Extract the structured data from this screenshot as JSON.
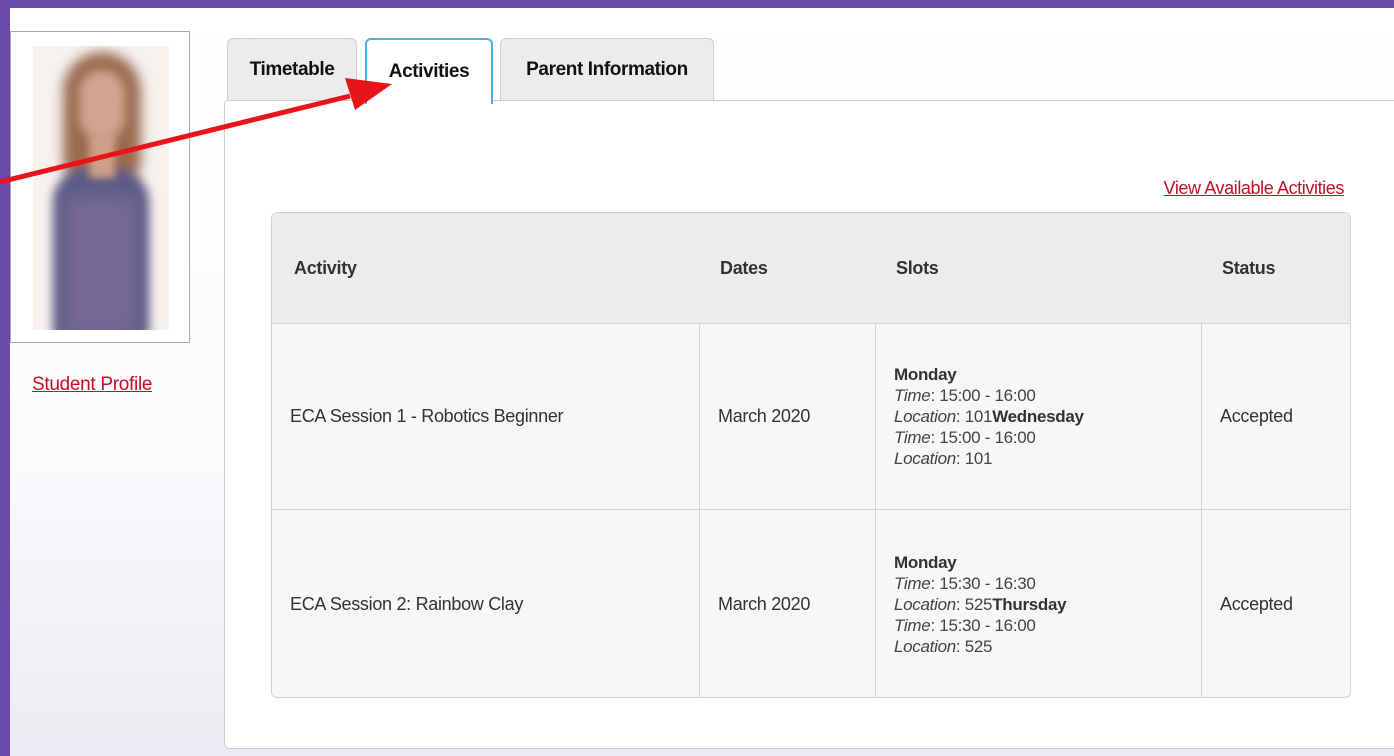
{
  "sidebar": {
    "profile_link": "Student Profile"
  },
  "tabs": [
    {
      "label": "Timetable"
    },
    {
      "label": "Activities"
    },
    {
      "label": "Parent Information"
    }
  ],
  "panel": {
    "view_activities_link": "View Available Activities"
  },
  "table": {
    "headers": [
      "Activity",
      "Dates",
      "Slots",
      "Status"
    ],
    "rows": [
      {
        "activity": "ECA Session 1 - Robotics Beginner",
        "dates": "March 2020",
        "slots": [
          {
            "day": "Monday",
            "time_label": "Time",
            "time": ": 15:00 - 16:00",
            "location_label": "Location",
            "location": ": 101"
          },
          {
            "day": "Wednesday",
            "time_label": "Time",
            "time": ": 15:00 - 16:00",
            "location_label": "Location",
            "location": ": 101"
          }
        ],
        "status": "Accepted"
      },
      {
        "activity": "ECA Session 2: Rainbow Clay",
        "dates": "March 2020",
        "slots": [
          {
            "day": "Monday",
            "time_label": "Time",
            "time": ": 15:30 - 16:30",
            "location_label": "Location",
            "location": ": 525"
          },
          {
            "day": "Thursday",
            "time_label": "Time",
            "time": ": 15:30 - 16:00",
            "location_label": "Location",
            "location": ": 525"
          }
        ],
        "status": "Accepted"
      }
    ]
  },
  "colors": {
    "frame": "#6a4aa6",
    "link": "#c0102a",
    "active_tab_border": "#4ab0e0",
    "annotation_arrow": "#e8141a"
  }
}
